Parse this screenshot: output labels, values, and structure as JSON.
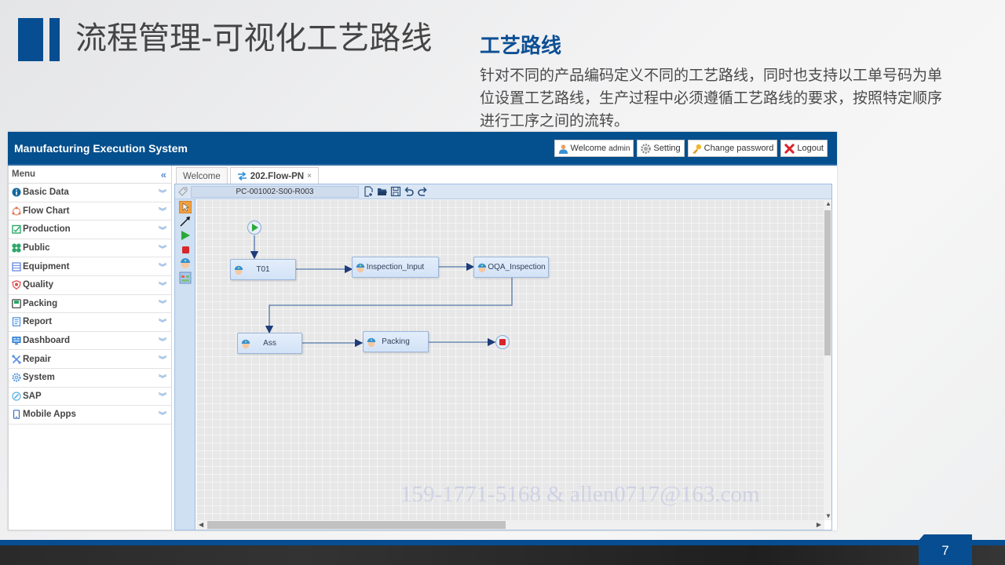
{
  "slide": {
    "title": "流程管理-可视化工艺路线",
    "side_heading": "工艺路线",
    "side_description": "针对不同的产品编码定义不同的工艺路线，同时也支持以工单号码为单位设置工艺路线，生产过程中必须遵循工艺路线的要求，按照特定顺序进行工序之间的流转。",
    "page_number": "7",
    "watermark": "159-1771-5168 & allen0717@163.com"
  },
  "app": {
    "title": "Manufacturing Execution System",
    "header_buttons": [
      {
        "label": "Welcome",
        "sub": "admin",
        "icon": "user-icon"
      },
      {
        "label": "Setting",
        "icon": "gear-icon"
      },
      {
        "label": "Change password",
        "icon": "key-icon"
      },
      {
        "label": "Logout",
        "icon": "logout-x-icon"
      }
    ],
    "colors": {
      "header": "#044f8d",
      "accent": "#064d91"
    }
  },
  "sidebar": {
    "header": "Menu",
    "items": [
      {
        "label": "Basic Data",
        "icon": "info-icon"
      },
      {
        "label": "Flow Chart",
        "icon": "flow-chart-icon"
      },
      {
        "label": "Production",
        "icon": "production-icon"
      },
      {
        "label": "Public",
        "icon": "public-icon"
      },
      {
        "label": "Equipment",
        "icon": "equipment-icon"
      },
      {
        "label": "Quality",
        "icon": "quality-shield-icon"
      },
      {
        "label": "Packing",
        "icon": "packing-icon"
      },
      {
        "label": "Report",
        "icon": "report-icon"
      },
      {
        "label": "Dashboard",
        "icon": "dashboard-icon"
      },
      {
        "label": "Repair",
        "icon": "repair-tools-icon"
      },
      {
        "label": "System",
        "icon": "system-gear-icon"
      },
      {
        "label": "SAP",
        "icon": "sap-icon"
      },
      {
        "label": "Mobile Apps",
        "icon": "mobile-icon"
      }
    ]
  },
  "tabs": [
    {
      "label": "Welcome",
      "active": false
    },
    {
      "label": "202.Flow-PN",
      "active": true,
      "closable": "×"
    }
  ],
  "editor": {
    "route_code": "PC-001002-S00-R003",
    "toolbar_icons": [
      "new-file-icon",
      "open-folder-icon",
      "save-icon",
      "undo-icon",
      "redo-icon"
    ],
    "palette": [
      "select-pointer-icon",
      "connector-arrow-icon",
      "start-node-icon",
      "end-node-icon",
      "task-worker-icon",
      "form-icon"
    ],
    "nodes": [
      {
        "id": "start",
        "type": "start"
      },
      {
        "id": "T01",
        "label": "T01",
        "type": "task"
      },
      {
        "id": "Inspection_Input",
        "label": "Inspection_Input",
        "type": "task"
      },
      {
        "id": "OQA_Inspection",
        "label": "OQA_Inspection",
        "type": "task"
      },
      {
        "id": "Ass",
        "label": "Ass",
        "type": "task"
      },
      {
        "id": "Packing",
        "label": "Packing",
        "type": "task"
      },
      {
        "id": "end",
        "type": "end"
      }
    ],
    "edges": [
      [
        "start",
        "T01"
      ],
      [
        "T01",
        "Inspection_Input"
      ],
      [
        "Inspection_Input",
        "OQA_Inspection"
      ],
      [
        "OQA_Inspection",
        "Ass"
      ],
      [
        "Ass",
        "Packing"
      ],
      [
        "Packing",
        "end"
      ]
    ]
  }
}
